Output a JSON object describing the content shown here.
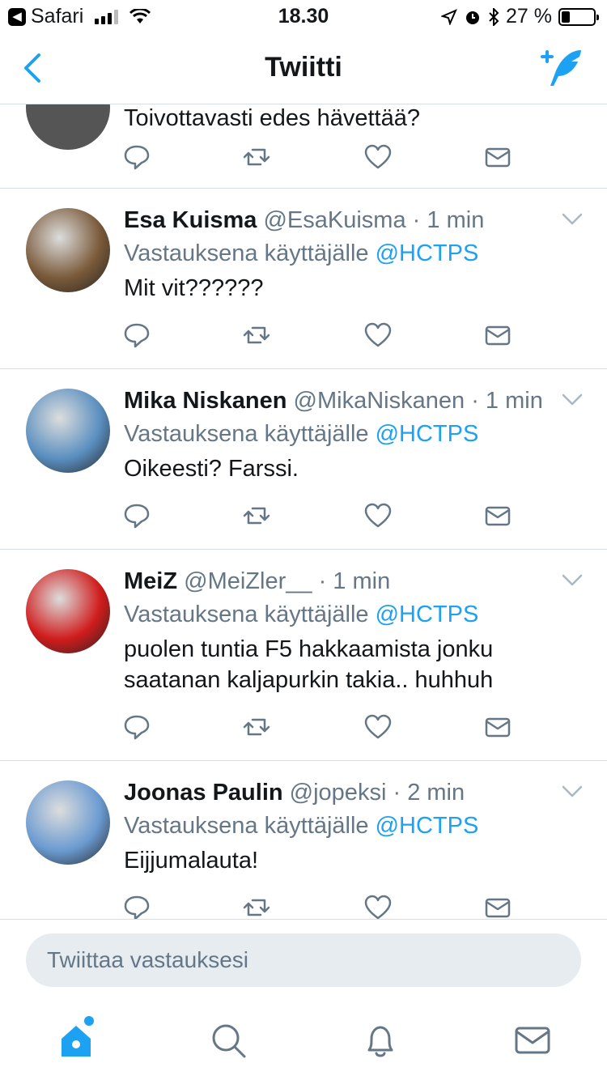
{
  "status_bar": {
    "app_back": "Safari",
    "time": "18.30",
    "battery": "27 %",
    "battery_level": 0.27
  },
  "nav": {
    "title": "Twiitti",
    "back_icon": "chevron-left-icon",
    "compose_icon": "compose-tweet-icon"
  },
  "partial_tweet": {
    "text": "Toivottavasti edes hävettää?"
  },
  "reply_prefix": "Vastauksena käyttäjälle",
  "tweets": [
    {
      "name": "Esa Kuisma",
      "handle": "@EsaKuisma",
      "time": "1 min",
      "mention": "@HCTPS",
      "text": "Mit vit??????",
      "avatar_color": "#7a5a3a"
    },
    {
      "name": "Mika Niskanen",
      "handle": "@MikaNiskanen",
      "time": "1 min",
      "mention": "@HCTPS",
      "text": "Oikeesti? Farssi.",
      "avatar_color": "#5a8fc0"
    },
    {
      "name": "MeiZ",
      "handle": "@MeiZler__",
      "time": "1 min",
      "mention": "@HCTPS",
      "text": "puolen tuntia F5 hakkaamista jonku saatanan kaljapurkin takia.. huhhuh",
      "avatar_color": "#d01c1c"
    },
    {
      "name": "Joonas Paulin",
      "handle": "@jopeksi",
      "time": "2 min",
      "mention": "@HCTPS",
      "text": "Eijjumalauta!",
      "avatar_color": "#6b9bd1"
    }
  ],
  "separator_dot": "·",
  "reply_box": {
    "placeholder": "Twiittaa vastauksesi"
  },
  "colors": {
    "accent": "#1da1f2",
    "secondary_text": "#657786",
    "divider": "#d8dde1"
  },
  "tab_bar": [
    "home-icon",
    "search-icon",
    "notifications-icon",
    "messages-icon"
  ]
}
